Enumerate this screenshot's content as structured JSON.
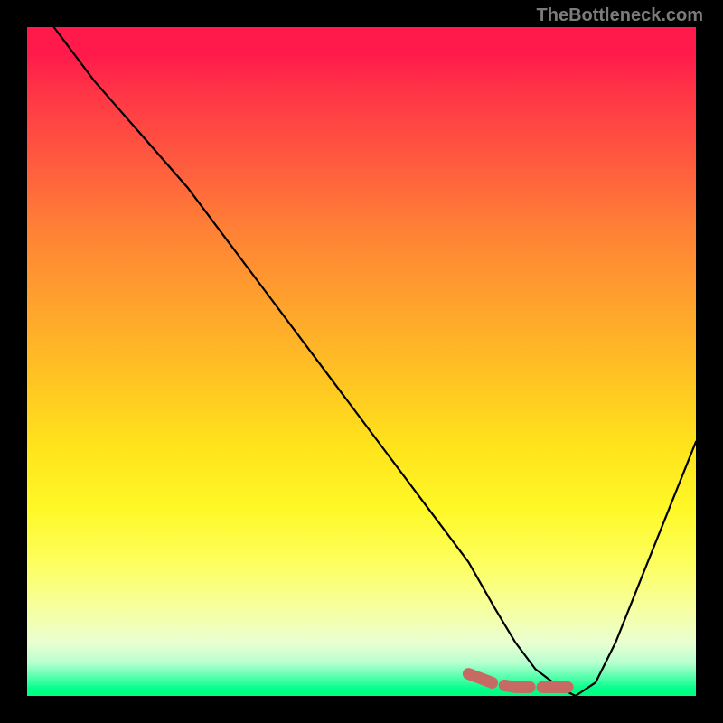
{
  "watermark": "TheBottleneck.com",
  "chart_data": {
    "type": "line",
    "title": "",
    "xlabel": "",
    "ylabel": "",
    "xlim": [
      0,
      100
    ],
    "ylim": [
      0,
      100
    ],
    "grid": false,
    "legend": false,
    "series": [
      {
        "name": "bottleneck-curve",
        "color": "#000000",
        "x": [
          4,
          10,
          17,
          24,
          27,
          30,
          36,
          42,
          48,
          54,
          60,
          66,
          70,
          73,
          76,
          80,
          82,
          85,
          88,
          92,
          96,
          100
        ],
        "y": [
          100,
          92,
          84,
          76,
          72,
          68,
          60,
          52,
          44,
          36,
          28,
          20,
          13,
          8,
          4,
          1,
          0,
          2,
          8,
          18,
          28,
          38
        ]
      }
    ],
    "markers": [
      {
        "name": "recommended-range",
        "color": "#c66a63",
        "style": "thick-dashed",
        "x": [
          66,
          70,
          73,
          76,
          79,
          82
        ],
        "y": [
          3.3,
          1.8,
          1.3,
          1.3,
          1.3,
          1.3
        ]
      }
    ],
    "background": {
      "type": "vertical-gradient",
      "description": "red (top, high bottleneck) to green (bottom, low bottleneck)",
      "stops": [
        {
          "pos": 0.0,
          "color": "#ff1a4b"
        },
        {
          "pos": 0.42,
          "color": "#ffa42c"
        },
        {
          "pos": 0.72,
          "color": "#fff827"
        },
        {
          "pos": 0.97,
          "color": "#5fffb0"
        },
        {
          "pos": 1.0,
          "color": "#00ff7a"
        }
      ]
    }
  }
}
